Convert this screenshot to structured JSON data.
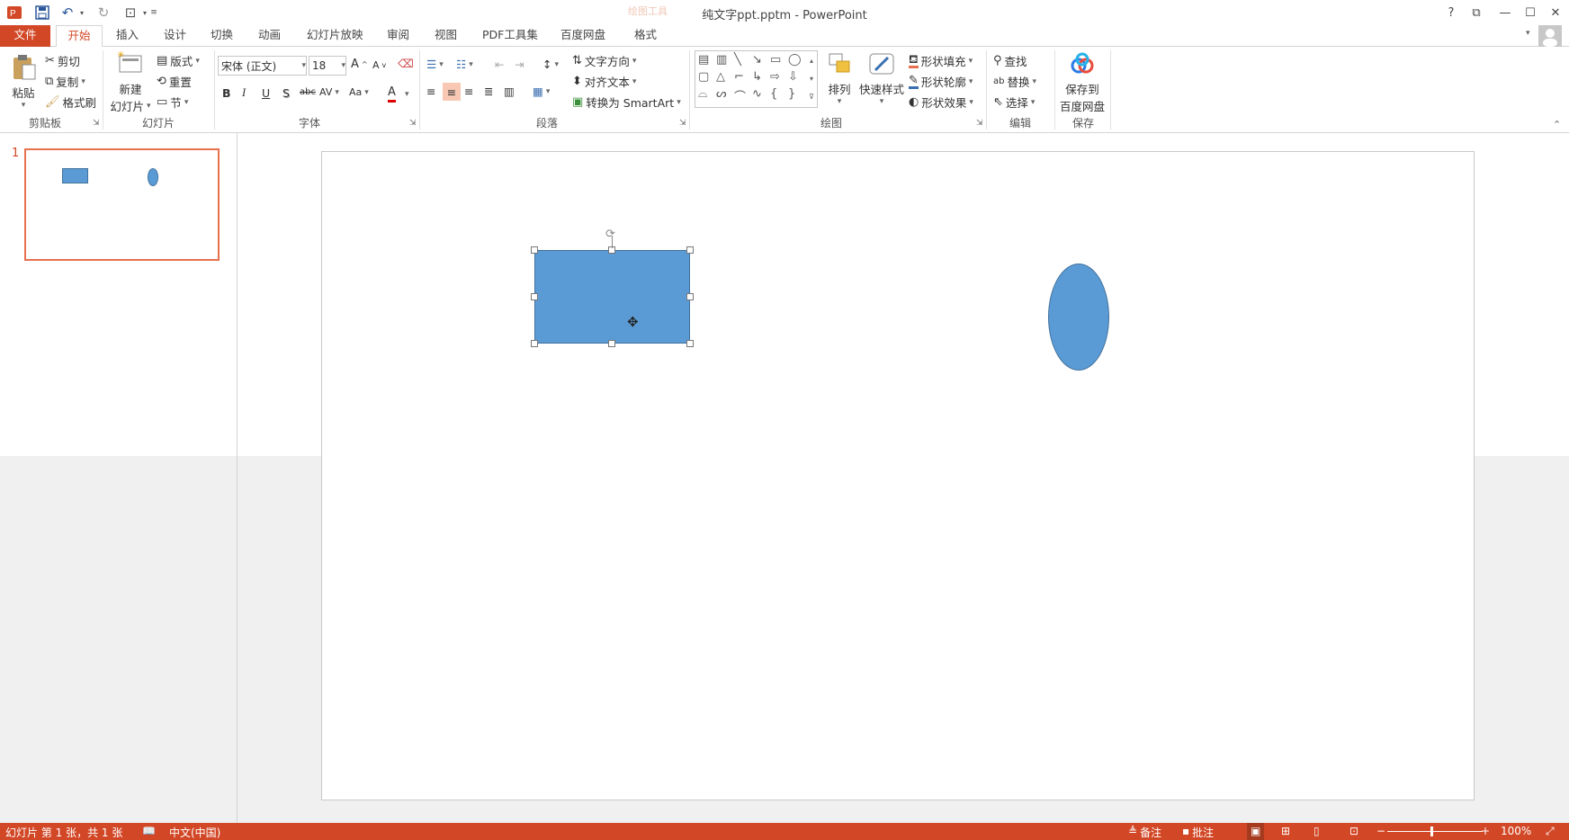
{
  "titlebar": {
    "title": "纯文字ppt.pptm - PowerPoint",
    "faded_label": "绘图工具",
    "help": "?",
    "quick_access": [
      "powerpoint-logo-icon",
      "save-icon",
      "undo-icon",
      "redo-icon",
      "start-slideshow-icon",
      "customize-qat-icon"
    ]
  },
  "tabs": [
    "文件",
    "开始",
    "插入",
    "设计",
    "切换",
    "动画",
    "幻灯片放映",
    "审阅",
    "视图",
    "PDF工具集",
    "百度网盘",
    "格式"
  ],
  "ribbon": {
    "clipboard": {
      "paste": "粘贴",
      "cut": "剪切",
      "copy": "复制",
      "format_painter": "格式刷",
      "label": "剪贴板"
    },
    "slides": {
      "new_slide_line1": "新建",
      "new_slide_line2": "幻灯片",
      "layout": "版式",
      "reset": "重置",
      "section": "节",
      "label": "幻灯片"
    },
    "font": {
      "font_name": "宋体 (正文)",
      "font_size": "18",
      "bold": "B",
      "italic": "I",
      "underline": "U",
      "shadow": "S",
      "strike": "abc",
      "spacing": "AV",
      "case": "Aa",
      "color": "A",
      "grow": "A",
      "shrink": "A",
      "label": "字体"
    },
    "paragraph": {
      "text_direction": "文字方向",
      "align_text": "对齐文本",
      "smartart": "转换为 SmartArt",
      "label": "段落"
    },
    "drawing": {
      "arrange": "排列",
      "quick_styles": "快速样式",
      "fill": "形状填充",
      "outline": "形状轮廓",
      "effects": "形状效果",
      "label": "绘图"
    },
    "editing": {
      "find": "查找",
      "replace": "替换",
      "select": "选择",
      "label": "编辑"
    },
    "save": {
      "line1": "保存到",
      "line2": "百度网盘",
      "label": "保存"
    }
  },
  "thumbnail": {
    "number": "1"
  },
  "status": {
    "slide_info": "幻灯片 第 1 张，共 1 张",
    "language": "中文(中国)",
    "notes": "备注",
    "comments": "批注",
    "zoom": "100%",
    "minus": "−",
    "plus": "+"
  },
  "colors": {
    "accent": "#d24726",
    "shape_fill": "#5b9bd5",
    "shape_stroke": "#41719c",
    "thumb_border": "#e8704f"
  }
}
